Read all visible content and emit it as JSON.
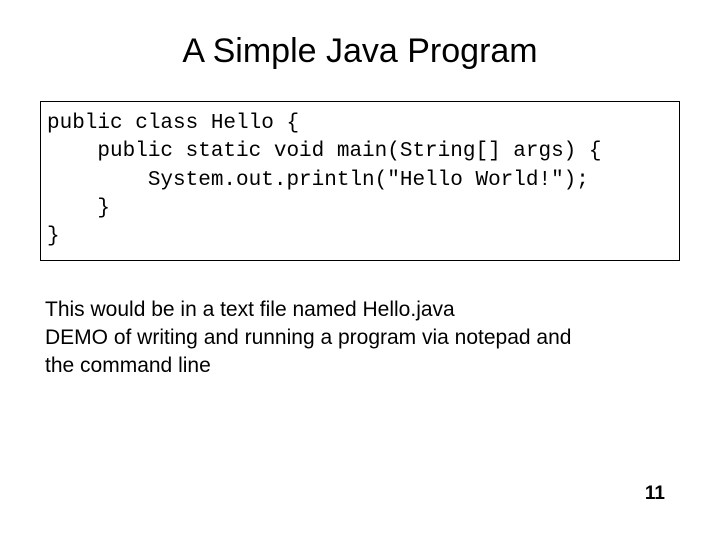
{
  "title": "A Simple Java Program",
  "code": {
    "line1": "public class Hello {",
    "line2": "    public static void main(String[] args) {",
    "line3": "        System.out.println(\"Hello World!\");",
    "line4": "    }",
    "line5": "}"
  },
  "description": {
    "line1": "This would be in a text file named Hello.java",
    "line2": "DEMO of writing and running a program via notepad and",
    "line3": "the command line"
  },
  "page_number": "11"
}
